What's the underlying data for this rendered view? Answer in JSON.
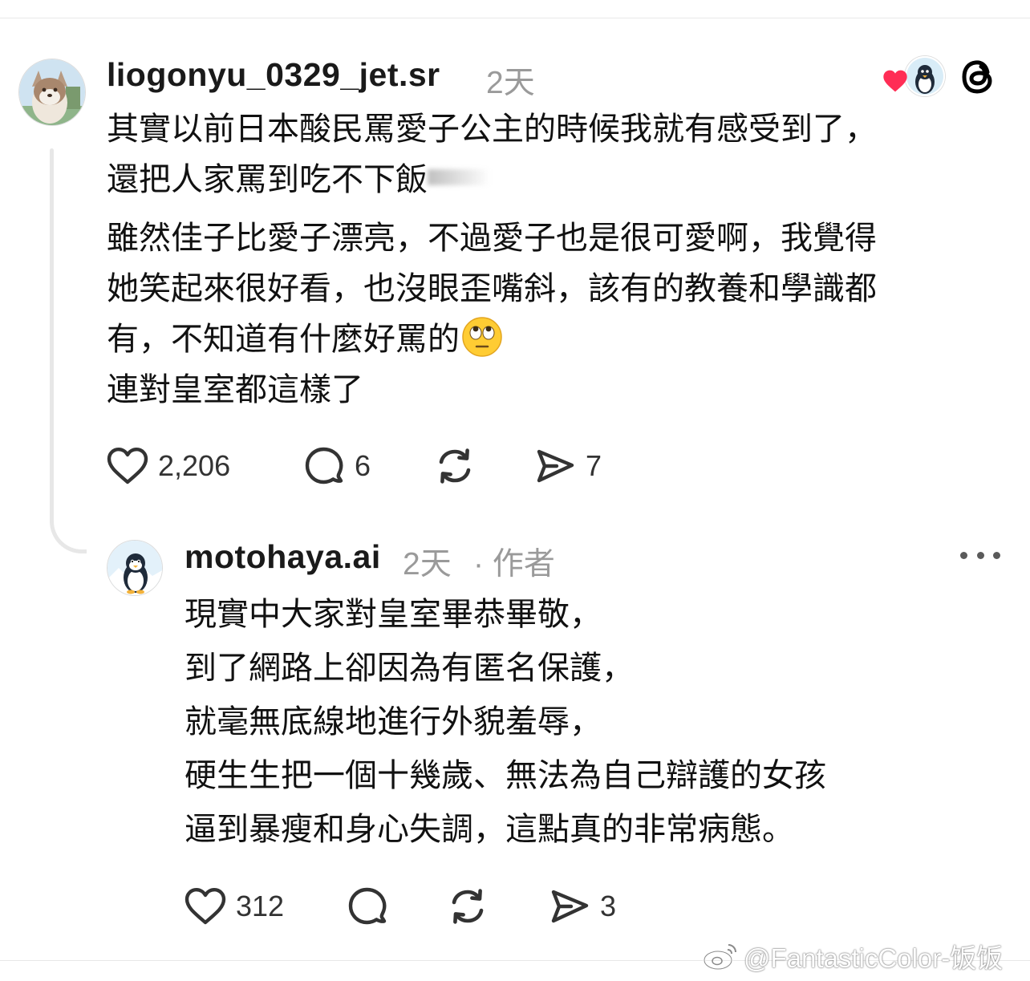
{
  "post": {
    "username": "liogonyu_0329_jet.sr",
    "time": "2天",
    "lines": [
      "其實以前日本酸民罵愛子公主的時候我就有感受到了，",
      "還把人家罵到吃不下飯",
      "雖然佳子比愛子漂亮，不過愛子也是很可愛啊，我覺得",
      "她笑起來很好看，也沒眼歪嘴斜，該有的教養和學識都",
      "有，不知道有什麼好罵的",
      "連對皇室都這樣了"
    ],
    "emoji_icon": "face-with-rolling-eyes-emoji",
    "likes": "2,206",
    "replies": "6",
    "shares": "7"
  },
  "reply": {
    "username": "motohaya.ai",
    "time": "2天",
    "author_tag": "· 作者",
    "lines": [
      "現實中大家對皇室畢恭畢敬，",
      "到了網路上卻因為有匿名保護，",
      "就毫無底線地進行外貌羞辱，",
      "硬生生把一個十幾歲、無法為自己辯護的女孩",
      "逼到暴瘦和身心失調，這點真的非常病態。"
    ],
    "likes": "312",
    "shares": "3"
  },
  "watermark": "@FantasticColor-饭饭",
  "icons": {
    "like": "heart-outline-icon",
    "reply": "speech-bubble-icon",
    "repost": "repost-arrows-icon",
    "share": "send-arrow-icon",
    "threads_logo": "threads-logo-icon",
    "more": "more-dots-icon",
    "liked_badge": "red-heart-icon"
  },
  "colors": {
    "text": "#111111",
    "secondary": "#9a9a9a",
    "heart": "#ff2d55"
  }
}
